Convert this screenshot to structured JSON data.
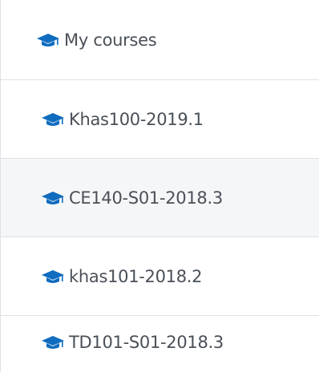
{
  "nav": {
    "header": {
      "icon": "graduation-cap-icon",
      "label": "My courses"
    },
    "courses": [
      {
        "icon": "graduation-cap-icon",
        "label": "Khas100-2019.1"
      },
      {
        "icon": "graduation-cap-icon",
        "label": "CE140-S01-2018.3"
      },
      {
        "icon": "graduation-cap-icon",
        "label": "khas101-2018.2"
      },
      {
        "icon": "graduation-cap-icon",
        "label": "TD101-S01-2018.3"
      }
    ],
    "colors": {
      "icon": "#0f6cbf",
      "text": "#4a5058",
      "divider": "#dee2e6",
      "row_highlight": "#f5f6f8"
    }
  }
}
